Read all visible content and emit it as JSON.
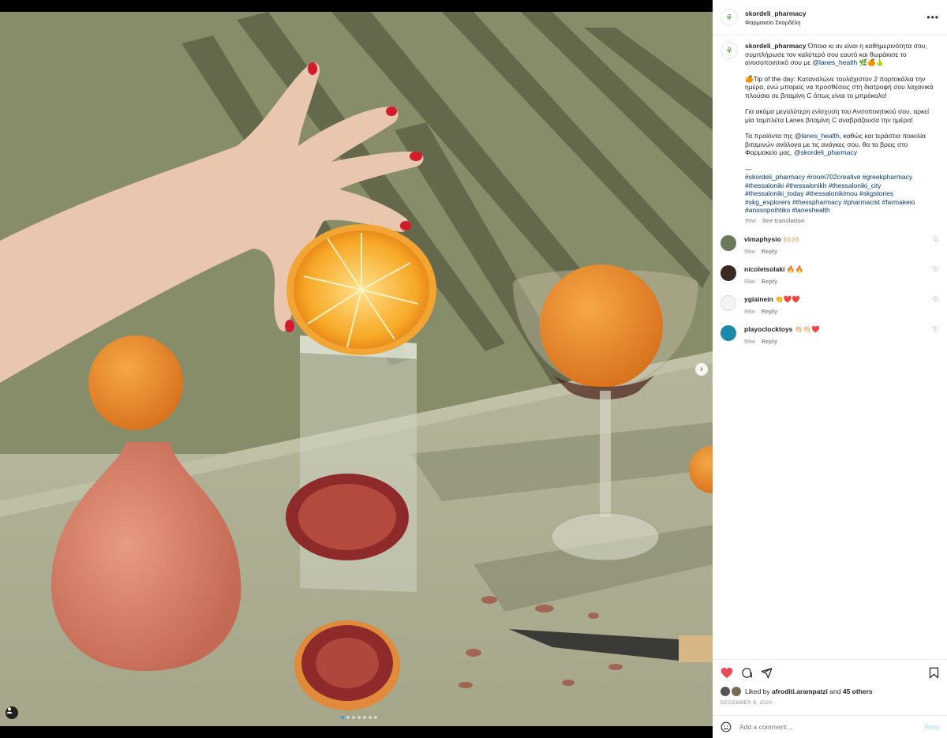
{
  "post": {
    "username": "skordeli_pharmacy",
    "location": "Φαρμακείο Σκορδέλη",
    "more_icon": "more-horizontal-icon",
    "caption": {
      "username": "skordeli_pharmacy",
      "p1_text": "Όποια κι αν είναι η καθημερινότητα σου, συμπλήρωσε τον καλύτερό σου εαυτό και θωράκισε το ανοσοποιητικό σου με",
      "p1_mention": "@lanes_health",
      "p1_emoji": "🌿🍊🍐",
      "p2": "🍊Tip of the day: Καταναλώνε τουλάχιστον 2 πορτοκάλια την ημέρα, ενώ μπορείς να προσθέσεις στη διατροφή σου λαχανικά πλούσια σε βιταμίνη C όπως είναι το μπρόκολο!",
      "p3": "Για ακόμα μεγαλύτερη ενίσχυση του Ανσοποιητικού σου, αρκεί μία ταμπλέτα Lanes βιταμίνη C αναβράζουσα την ημέρα!",
      "p4_a": "Τα προϊόντα της",
      "p4_mention1": "@lanes_health",
      "p4_b": ", καθώς και τεράστια ποικιλία βιταμινών ανάλογα με τις ανάγκες σου, θα τα βρεις στο Φαρμακείο μας.",
      "p4_mention2": "@skordeli_pharmacy",
      "separator": "—",
      "hashtags": "#skordeli_pharmacy #room702creative #greekpharmacy #thessaloniki #thessalonikh #thessaloniki_city #thessaloniki_today #thessalonikimou #skgstories #skg_explorers #thesspharmacy #pharmacist #farmakeio #anosopoihtiko #laneshealth",
      "time": "99w",
      "see_translation": "See translation"
    },
    "comments": [
      {
        "user": "vimaphysio",
        "text": "🙌🏻🙌🏻",
        "time": "99w",
        "reply": "Reply",
        "color": "#6b7a5a"
      },
      {
        "user": "nicoletsolaki",
        "text": "🔥🔥",
        "time": "99w",
        "reply": "Reply",
        "color": "#3a2a22"
      },
      {
        "user": "ygiainein",
        "text": "👏❤️❤️",
        "time": "99w",
        "reply": "Reply",
        "color": "#f4f4f4"
      },
      {
        "user": "playoclocktoys",
        "text": "👏🏻👏🏻❤️",
        "time": "99w",
        "reply": "Reply",
        "color": "#1a8aa8"
      }
    ],
    "actions": {
      "like_icon": "heart-filled-icon",
      "comment_icon": "comment-icon",
      "share_icon": "share-icon",
      "save_icon": "bookmark-icon",
      "liked_by_prefix": "Liked by",
      "liked_by_user": "afroditi.arampatzi",
      "liked_by_and": "and",
      "liked_by_others": "45 others",
      "date": "DECEMBER 8, 2020"
    },
    "add_comment": {
      "placeholder": "Add a comment...",
      "post_label": "Post",
      "emoji_icon": "smiley-icon"
    },
    "carousel": {
      "count": 7,
      "active": 0
    }
  },
  "colors": {
    "like": "#ed4956",
    "link": "#00376b",
    "muted": "#8e8e8e",
    "post_disabled": "#b2dffc"
  }
}
